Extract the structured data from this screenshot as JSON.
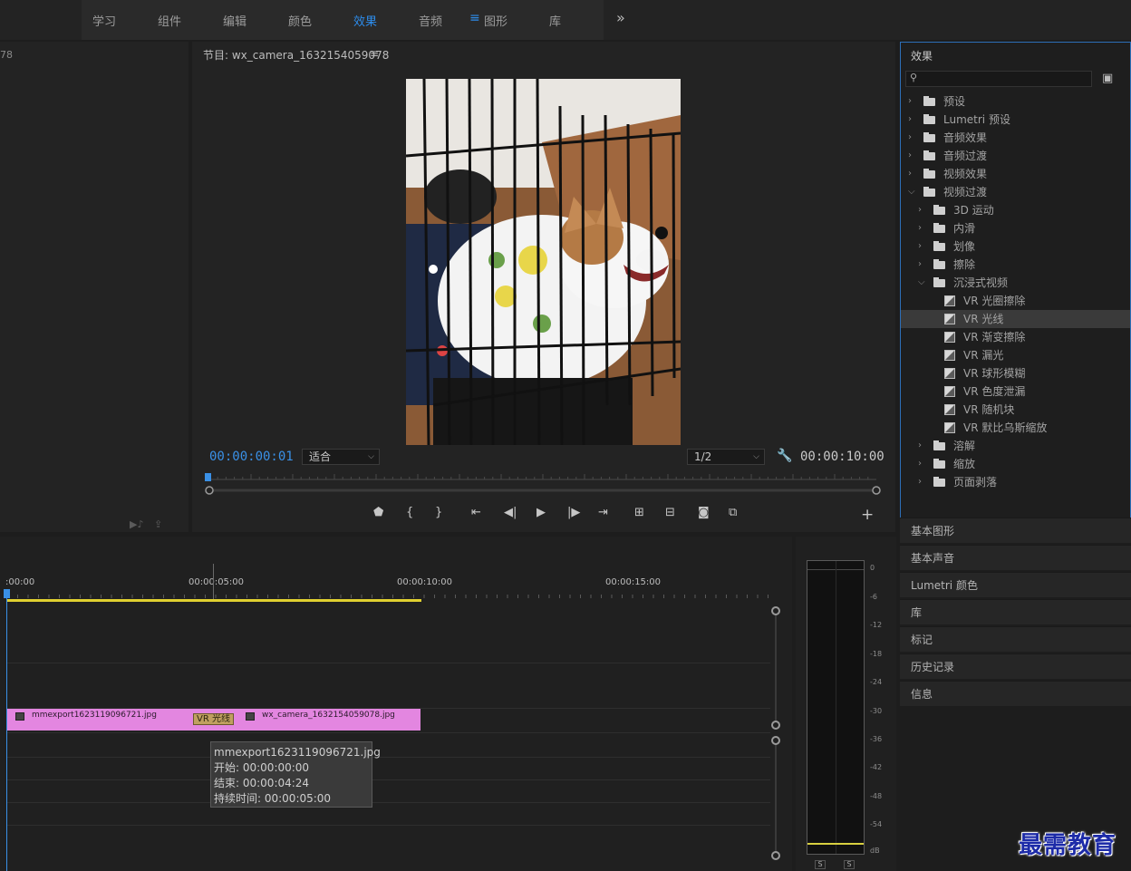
{
  "workspace_tabs": [
    "学习",
    "组件",
    "编辑",
    "颜色",
    "效果",
    "音频",
    "图形",
    "库"
  ],
  "active_tab": "效果",
  "source": {
    "timecode_fragment": "78"
  },
  "program": {
    "title": "节目: wx_camera_1632154059078",
    "current_time": "00:00:00:01",
    "zoom": "适合",
    "resolution": "1/2",
    "duration": "00:00:10:00"
  },
  "effects": {
    "title": "效果",
    "tree": [
      {
        "label": "预设",
        "level": 0,
        "kind": "folder-star"
      },
      {
        "label": "Lumetri 预设",
        "level": 0,
        "kind": "folder-star"
      },
      {
        "label": "音频效果",
        "level": 0,
        "kind": "folder"
      },
      {
        "label": "音频过渡",
        "level": 0,
        "kind": "folder"
      },
      {
        "label": "视频效果",
        "level": 0,
        "kind": "folder"
      },
      {
        "label": "视频过渡",
        "level": 0,
        "kind": "folder",
        "open": true
      },
      {
        "label": "3D 运动",
        "level": 1,
        "kind": "folder"
      },
      {
        "label": "内滑",
        "level": 1,
        "kind": "folder"
      },
      {
        "label": "划像",
        "level": 1,
        "kind": "folder"
      },
      {
        "label": "擦除",
        "level": 1,
        "kind": "folder"
      },
      {
        "label": "沉浸式视频",
        "level": 1,
        "kind": "folder",
        "open": true
      },
      {
        "label": "VR 光圈擦除",
        "level": 2,
        "kind": "effect"
      },
      {
        "label": "VR 光线",
        "level": 2,
        "kind": "effect",
        "selected": true
      },
      {
        "label": "VR 渐变擦除",
        "level": 2,
        "kind": "effect"
      },
      {
        "label": "VR 漏光",
        "level": 2,
        "kind": "effect"
      },
      {
        "label": "VR 球形模糊",
        "level": 2,
        "kind": "effect"
      },
      {
        "label": "VR 色度泄漏",
        "level": 2,
        "kind": "effect"
      },
      {
        "label": "VR 随机块",
        "level": 2,
        "kind": "effect"
      },
      {
        "label": "VR 默比乌斯缩放",
        "level": 2,
        "kind": "effect"
      },
      {
        "label": "溶解",
        "level": 1,
        "kind": "folder"
      },
      {
        "label": "缩放",
        "level": 1,
        "kind": "folder"
      },
      {
        "label": "页面剥落",
        "level": 1,
        "kind": "folder"
      }
    ]
  },
  "panels": [
    "基本图形",
    "基本声音",
    "Lumetri 颜色",
    "库",
    "标记",
    "历史记录",
    "信息"
  ],
  "timeline": {
    "ruler_labels": [
      ":00:00",
      "00:00:05:00",
      "00:00:10:00",
      "00:00:15:00"
    ],
    "clip_a": "mmexport1623119096721.jpg",
    "clip_b": "wx_camera_1632154059078.jpg",
    "transition": "VR 光线",
    "tooltip": {
      "name": "mmexport1623119096721.jpg",
      "start": "开始: 00:00:00:00",
      "end": "结束: 00:00:04:24",
      "duration": "持续时间: 00:00:05:00"
    }
  },
  "audio_meter": {
    "scale": [
      "0",
      "-6",
      "-12",
      "-18",
      "-24",
      "-30",
      "-36",
      "-42",
      "-48",
      "-54",
      "dB"
    ],
    "solo_labels": [
      "S",
      "S"
    ]
  },
  "watermark": "最需教育",
  "colors": {
    "accent": "#2d8ceb",
    "clip": "#e386e0",
    "inout": "#e0d030"
  }
}
